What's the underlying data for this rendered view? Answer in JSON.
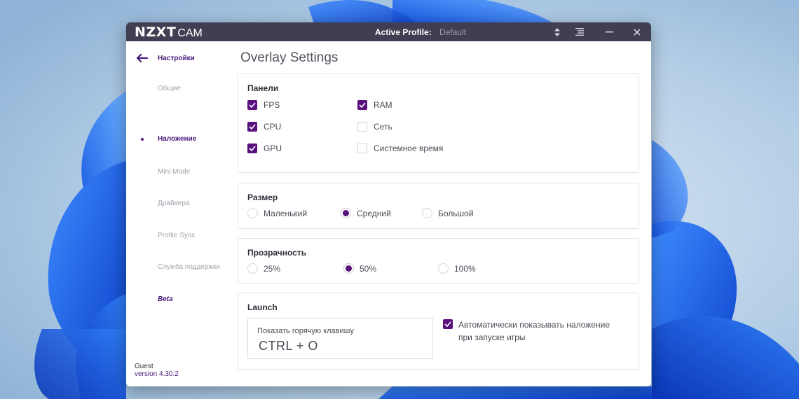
{
  "window": {
    "brand_primary": "NZXT",
    "brand_secondary": "CAM",
    "active_profile_label": "Active Profile:",
    "active_profile_value": "Default"
  },
  "sidebar": {
    "header": "Настройки",
    "items": [
      {
        "label": "Общие",
        "active": false
      },
      {
        "label": "Наложение",
        "active": true
      },
      {
        "label": "Mini Mode",
        "active": false
      },
      {
        "label": "Драйвера",
        "active": false
      },
      {
        "label": "Profile Sync",
        "active": false
      },
      {
        "label": "Служба поддержки",
        "active": false
      },
      {
        "label": "Beta",
        "active": false
      }
    ],
    "user": "Guest",
    "version": "version 4.30.2"
  },
  "main": {
    "title": "Overlay Settings",
    "panels_section": {
      "title": "Панели",
      "options": [
        {
          "label": "FPS",
          "checked": true
        },
        {
          "label": "CPU",
          "checked": true
        },
        {
          "label": "GPU",
          "checked": true
        },
        {
          "label": "RAM",
          "checked": true
        },
        {
          "label": "Сеть",
          "checked": false
        },
        {
          "label": "Системное время",
          "checked": false
        }
      ]
    },
    "size_section": {
      "title": "Размер",
      "options": [
        {
          "label": "Маленький",
          "selected": false
        },
        {
          "label": "Средний",
          "selected": true
        },
        {
          "label": "Большой",
          "selected": false
        }
      ]
    },
    "opacity_section": {
      "title": "Прозрачность",
      "options": [
        {
          "label": "25%",
          "selected": false
        },
        {
          "label": "50%",
          "selected": true
        },
        {
          "label": "100%",
          "selected": false
        }
      ]
    },
    "launch_section": {
      "title": "Launch",
      "hotkey_label": "Показать горячую клавишу",
      "hotkey_value": "CTRL + O",
      "auto_show_line1": "Автоматически показывать наложение",
      "auto_show_line2": "при запуске игры",
      "auto_show_checked": true
    }
  },
  "colors": {
    "accent": "#58117d",
    "titlebar": "#403e52",
    "sidebar_active": "#4a1a7a"
  },
  "icons": [
    "back-arrow-icon",
    "sort-arrows-icon",
    "menu-icon",
    "minimize-icon",
    "close-icon",
    "checkmark-icon"
  ]
}
